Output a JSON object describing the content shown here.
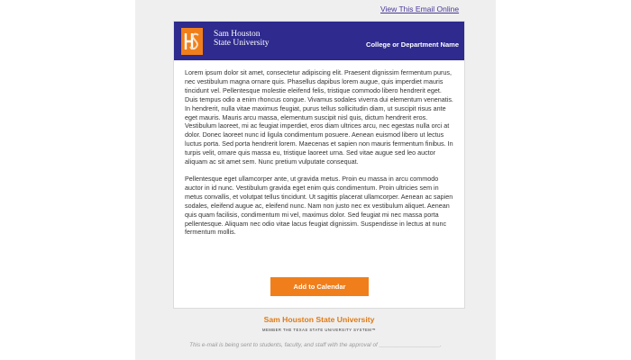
{
  "top_link": {
    "label": "View This Email Online"
  },
  "header": {
    "logo_line1": "Sam Houston",
    "logo_line2": "State University",
    "department": "College or Department Name"
  },
  "content": {
    "paragraphs": [
      "Lorem ipsum dolor sit amet, consectetur adipiscing elit. Praesent dignissim fermentum purus, nec vestibulum magna ornare quis. Phasellus dapibus lorem augue, quis imperdiet mauris tincidunt vel. Pellentesque molestie eleifend felis, tristique commodo libero hendrerit eget. Duis tempus odio a enim rhoncus congue. Vivamus sodales viverra dui elementum venenatis. In hendrerit, nulla vitae maximus feugiat, purus tellus sollicitudin diam, ut suscipit risus ante eget mauris. Mauris arcu massa, elementum suscipit nisl quis, dictum hendrerit eros. Vestibulum laoreet, mi ac feugiat imperdiet, eros diam ultrices arcu, nec egestas nulla orci at dolor. Donec laoreet nunc id ligula condimentum posuere. Aenean euismod libero ut lectus luctus porta. Sed porta hendrerit lorem. Maecenas et sapien non mauris fermentum finibus. In turpis velit, ornare quis massa eu, tristique laoreet urna. Sed vitae augue sed leo auctor aliquam ac sit amet sem. Nunc pretium vulputate consequat.",
      "Pellentesque eget ullamcorper ante, ut gravida metus. Proin eu massa in arcu commodo auctor in id nunc. Vestibulum gravida eget enim quis condimentum. Proin ultricies sem in metus convallis, et volutpat tellus tincidunt. Ut sagittis placerat ullamcorper. Aenean ac sapien sodales, eleifend augue ac, eleifend nunc. Nam non justo nec ex vestibulum aliquet. Aenean quis quam facilisis, condimentum mi vel, maximus dolor. Sed feugiat mi nec massa porta pellentesque. Aliquam nec odio vitae lacus feugiat dignissim. Suspendisse in lectus at nunc fermentum mollis."
    ],
    "cta_label": "Add to Calendar"
  },
  "footer": {
    "university": "Sam Houston State University",
    "member": "MEMBER THE TEXAS STATE UNIVERSITY SYSTEM™",
    "disclaimer": "This e-mail is being sent to students, faculty, and staff with the approval of ___________________."
  },
  "colors": {
    "brand_blue": "#2e2a8e",
    "brand_orange": "#f07f1b",
    "link": "#4b3a9a"
  },
  "icons": {
    "logo": "shsu-monogram-icon"
  }
}
